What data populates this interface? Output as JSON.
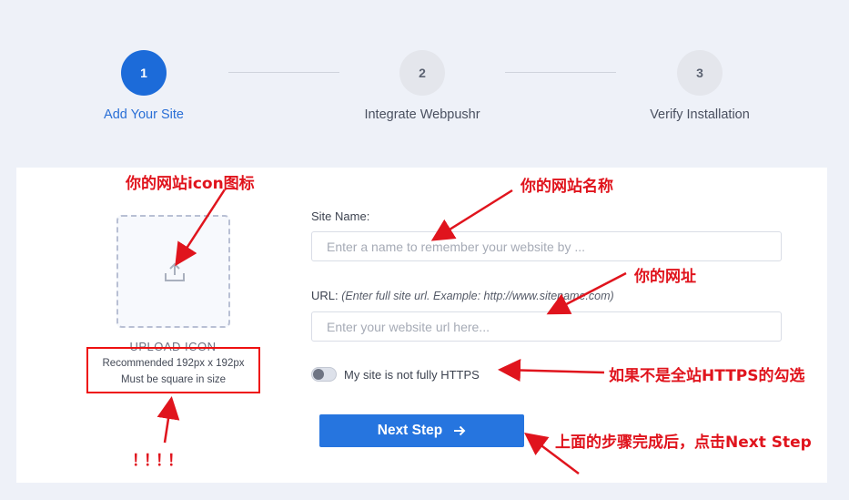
{
  "stepper": {
    "steps": [
      {
        "number": "1",
        "label": "Add Your Site",
        "state": "active"
      },
      {
        "number": "2",
        "label": "Integrate Webpushr",
        "state": "inactive"
      },
      {
        "number": "3",
        "label": "Verify Installation",
        "state": "inactive"
      }
    ]
  },
  "upload": {
    "title": "UPLOAD ICON",
    "hint_line1": "Recommended 192px x 192px",
    "hint_line2": "Must be square in size",
    "icon": "upload-icon"
  },
  "form": {
    "site_name_label": "Site Name:",
    "site_name_placeholder": "Enter a name to remember your website by ...",
    "url_label": "URL:",
    "url_hint": "(Enter full site url. Example: http://www.sitename.com)",
    "url_placeholder": "Enter your website url here...",
    "https_toggle_label": "My site is not fully HTTPS",
    "https_toggle_on": false,
    "next_button_label": "Next Step",
    "next_button_icon": "arrow-right-icon"
  },
  "annotations": {
    "icon_note": "你的网站icon图标",
    "name_note": "你的网站名称",
    "url_note": "你的网址",
    "https_note": "如果不是全站HTTPS的勾选",
    "next_note": "上面的步骤完成后，点击Next Step",
    "exclaim": "！！！！",
    "color": "#e0141d"
  },
  "colors": {
    "accent": "#1c6bd9",
    "button": "#2675df",
    "background": "#eef1f8"
  }
}
